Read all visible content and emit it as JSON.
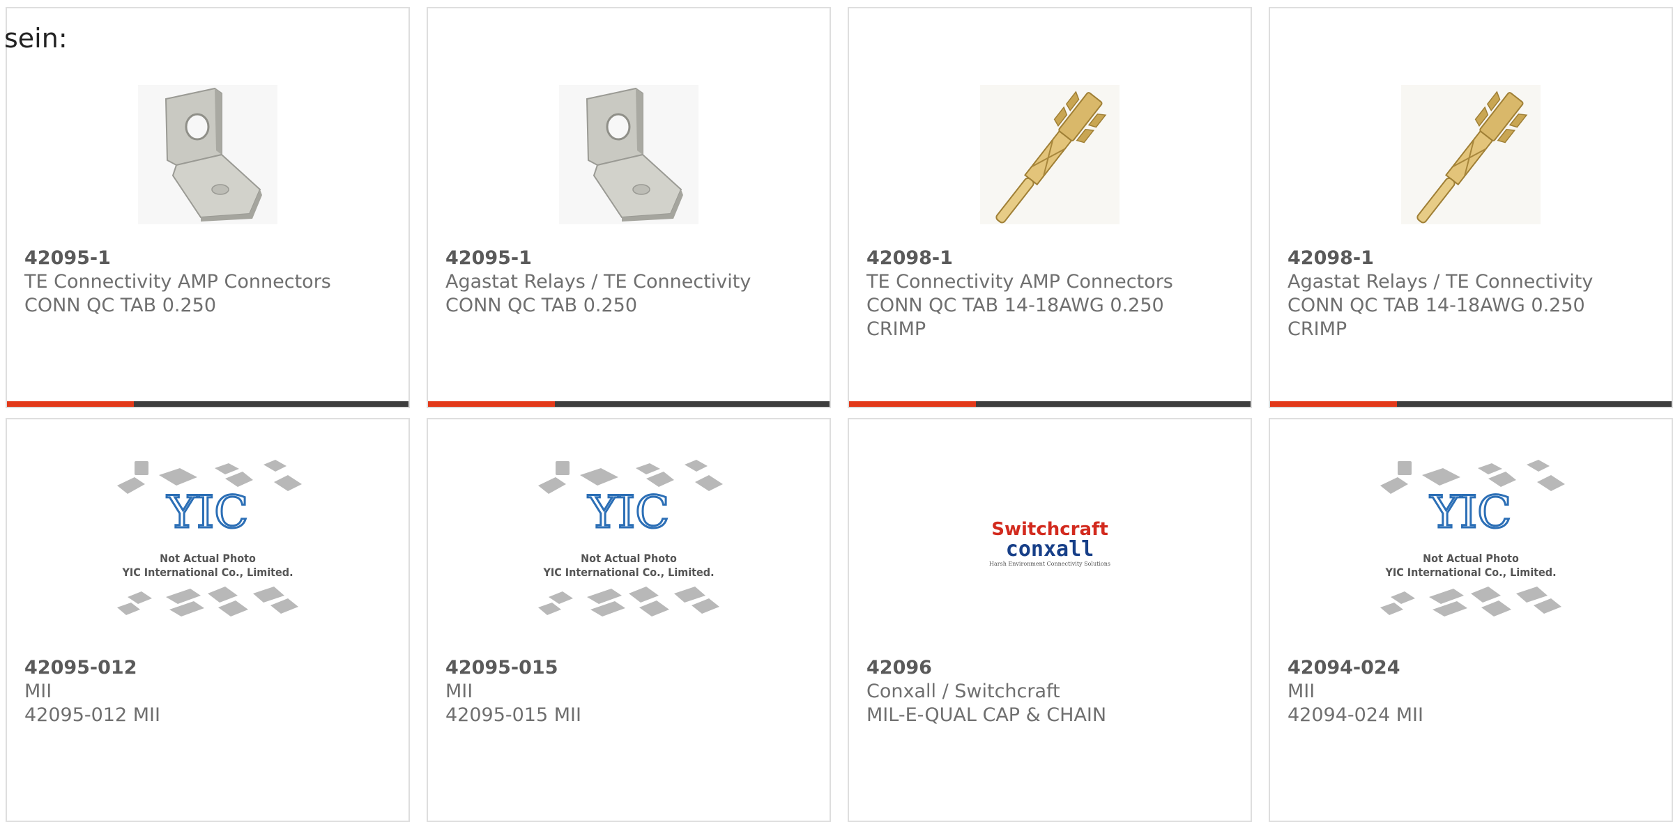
{
  "intro_text": "sein:",
  "cards": [
    {
      "part_number": "42095-1",
      "manufacturer": "TE Connectivity AMP Connectors",
      "description": "CONN QC TAB 0.250",
      "description_line2": "",
      "image": "angled-tab-terminal"
    },
    {
      "part_number": "42095-1",
      "manufacturer": "Agastat Relays / TE Connectivity",
      "description": "CONN QC TAB 0.250",
      "description_line2": "",
      "image": "angled-tab-terminal"
    },
    {
      "part_number": "42098-1",
      "manufacturer": "TE Connectivity AMP Connectors",
      "description": "CONN QC TAB 14-18AWG 0.250",
      "description_line2": "CRIMP",
      "image": "crimp-terminal-gold"
    },
    {
      "part_number": "42098-1",
      "manufacturer": "Agastat Relays / TE Connectivity",
      "description": "CONN QC TAB 14-18AWG 0.250",
      "description_line2": "CRIMP",
      "image": "crimp-terminal-gold"
    },
    {
      "part_number": "42095-012",
      "manufacturer": "MII",
      "description": "42095-012 MII",
      "description_line2": "",
      "image": "yic-placeholder",
      "placeholder_line1": "Not Actual Photo",
      "placeholder_line2": "YIC International Co., Limited."
    },
    {
      "part_number": "42095-015",
      "manufacturer": "MII",
      "description": "42095-015 MII",
      "description_line2": "",
      "image": "yic-placeholder",
      "placeholder_line1": "Not Actual Photo",
      "placeholder_line2": "YIC International Co., Limited."
    },
    {
      "part_number": "42096",
      "manufacturer": "Conxall / Switchcraft",
      "description": "MIL-E-QUAL CAP & CHAIN",
      "description_line2": "",
      "image": "switchcraft-conxall-logo",
      "logo_line1": "Switchcraft",
      "logo_line2": "conxall",
      "logo_tagline": "Harsh Environment Connectivity Solutions"
    },
    {
      "part_number": "42094-024",
      "manufacturer": "MII",
      "description": "42094-024 MII",
      "description_line2": "",
      "image": "yic-placeholder",
      "placeholder_line1": "Not Actual Photo",
      "placeholder_line2": "YIC International Co., Limited."
    }
  ],
  "colors": {
    "accent": "#e2391a",
    "bar": "#3d3d3d",
    "border": "#dedede",
    "text": "#6f6f6f"
  }
}
